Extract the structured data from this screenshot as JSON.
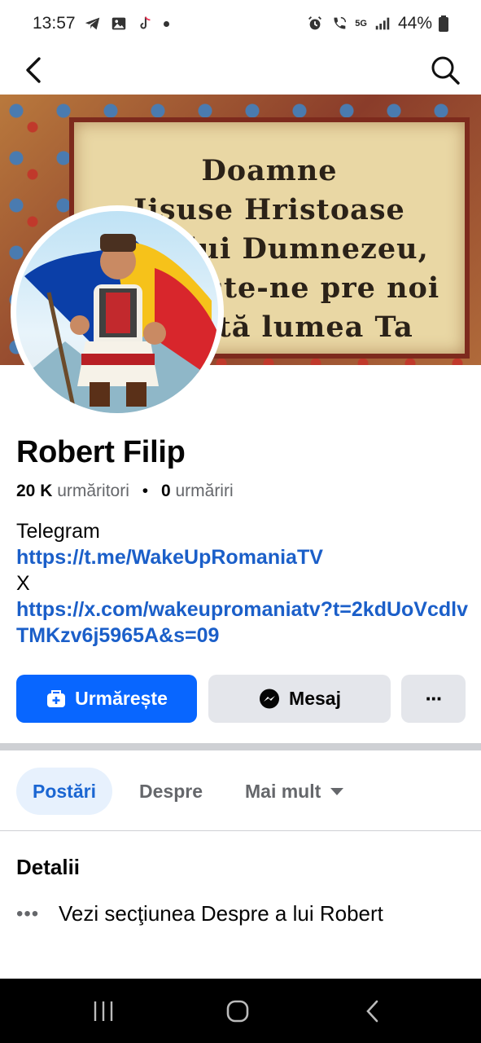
{
  "status_bar": {
    "time": "13:57",
    "battery": "44%",
    "network": "5G",
    "left_icons": [
      "telegram-icon",
      "gallery-icon",
      "tiktok-icon"
    ],
    "right_icons": [
      "alarm-icon",
      "wifi-call-icon",
      "signal-icon",
      "battery-icon"
    ]
  },
  "topnav": {
    "back_icon": "chevron-left-icon",
    "search_icon": "search-icon"
  },
  "cover": {
    "lines": [
      "Doamne",
      "Iisuse Hristoase",
      "Fiul lui Dumnezeu,",
      "Miluieşte-ne pre noi",
      "şi toată lumea Ta"
    ]
  },
  "profile": {
    "name": "Robert Filip",
    "followers_count": "20 K",
    "followers_label": "urmăritori",
    "following_count": "0",
    "following_label": "urmăriri",
    "separator": "•"
  },
  "bio": {
    "line1": "Telegram",
    "link1": "https://t.me/WakeUpRomaniaTV",
    "line2": "X",
    "link2": "https://x.com/wakeupromaniatv?t=2kdUoVcdlvTMKzv6j5965A&s=09"
  },
  "actions": {
    "follow_label": "Urmărește",
    "message_label": "Mesaj",
    "more_label": "···"
  },
  "tabs": {
    "posts": "Postări",
    "about": "Despre",
    "more": "Mai mult"
  },
  "details": {
    "title": "Detalii",
    "row_dots": "•••",
    "row_text": "Vezi secţiunea Despre a lui Robert"
  },
  "colors": {
    "accent": "#0866ff",
    "link": "#1b5fc9",
    "tab_active_bg": "#e7f1fd",
    "button_gray": "#e4e6eb"
  }
}
